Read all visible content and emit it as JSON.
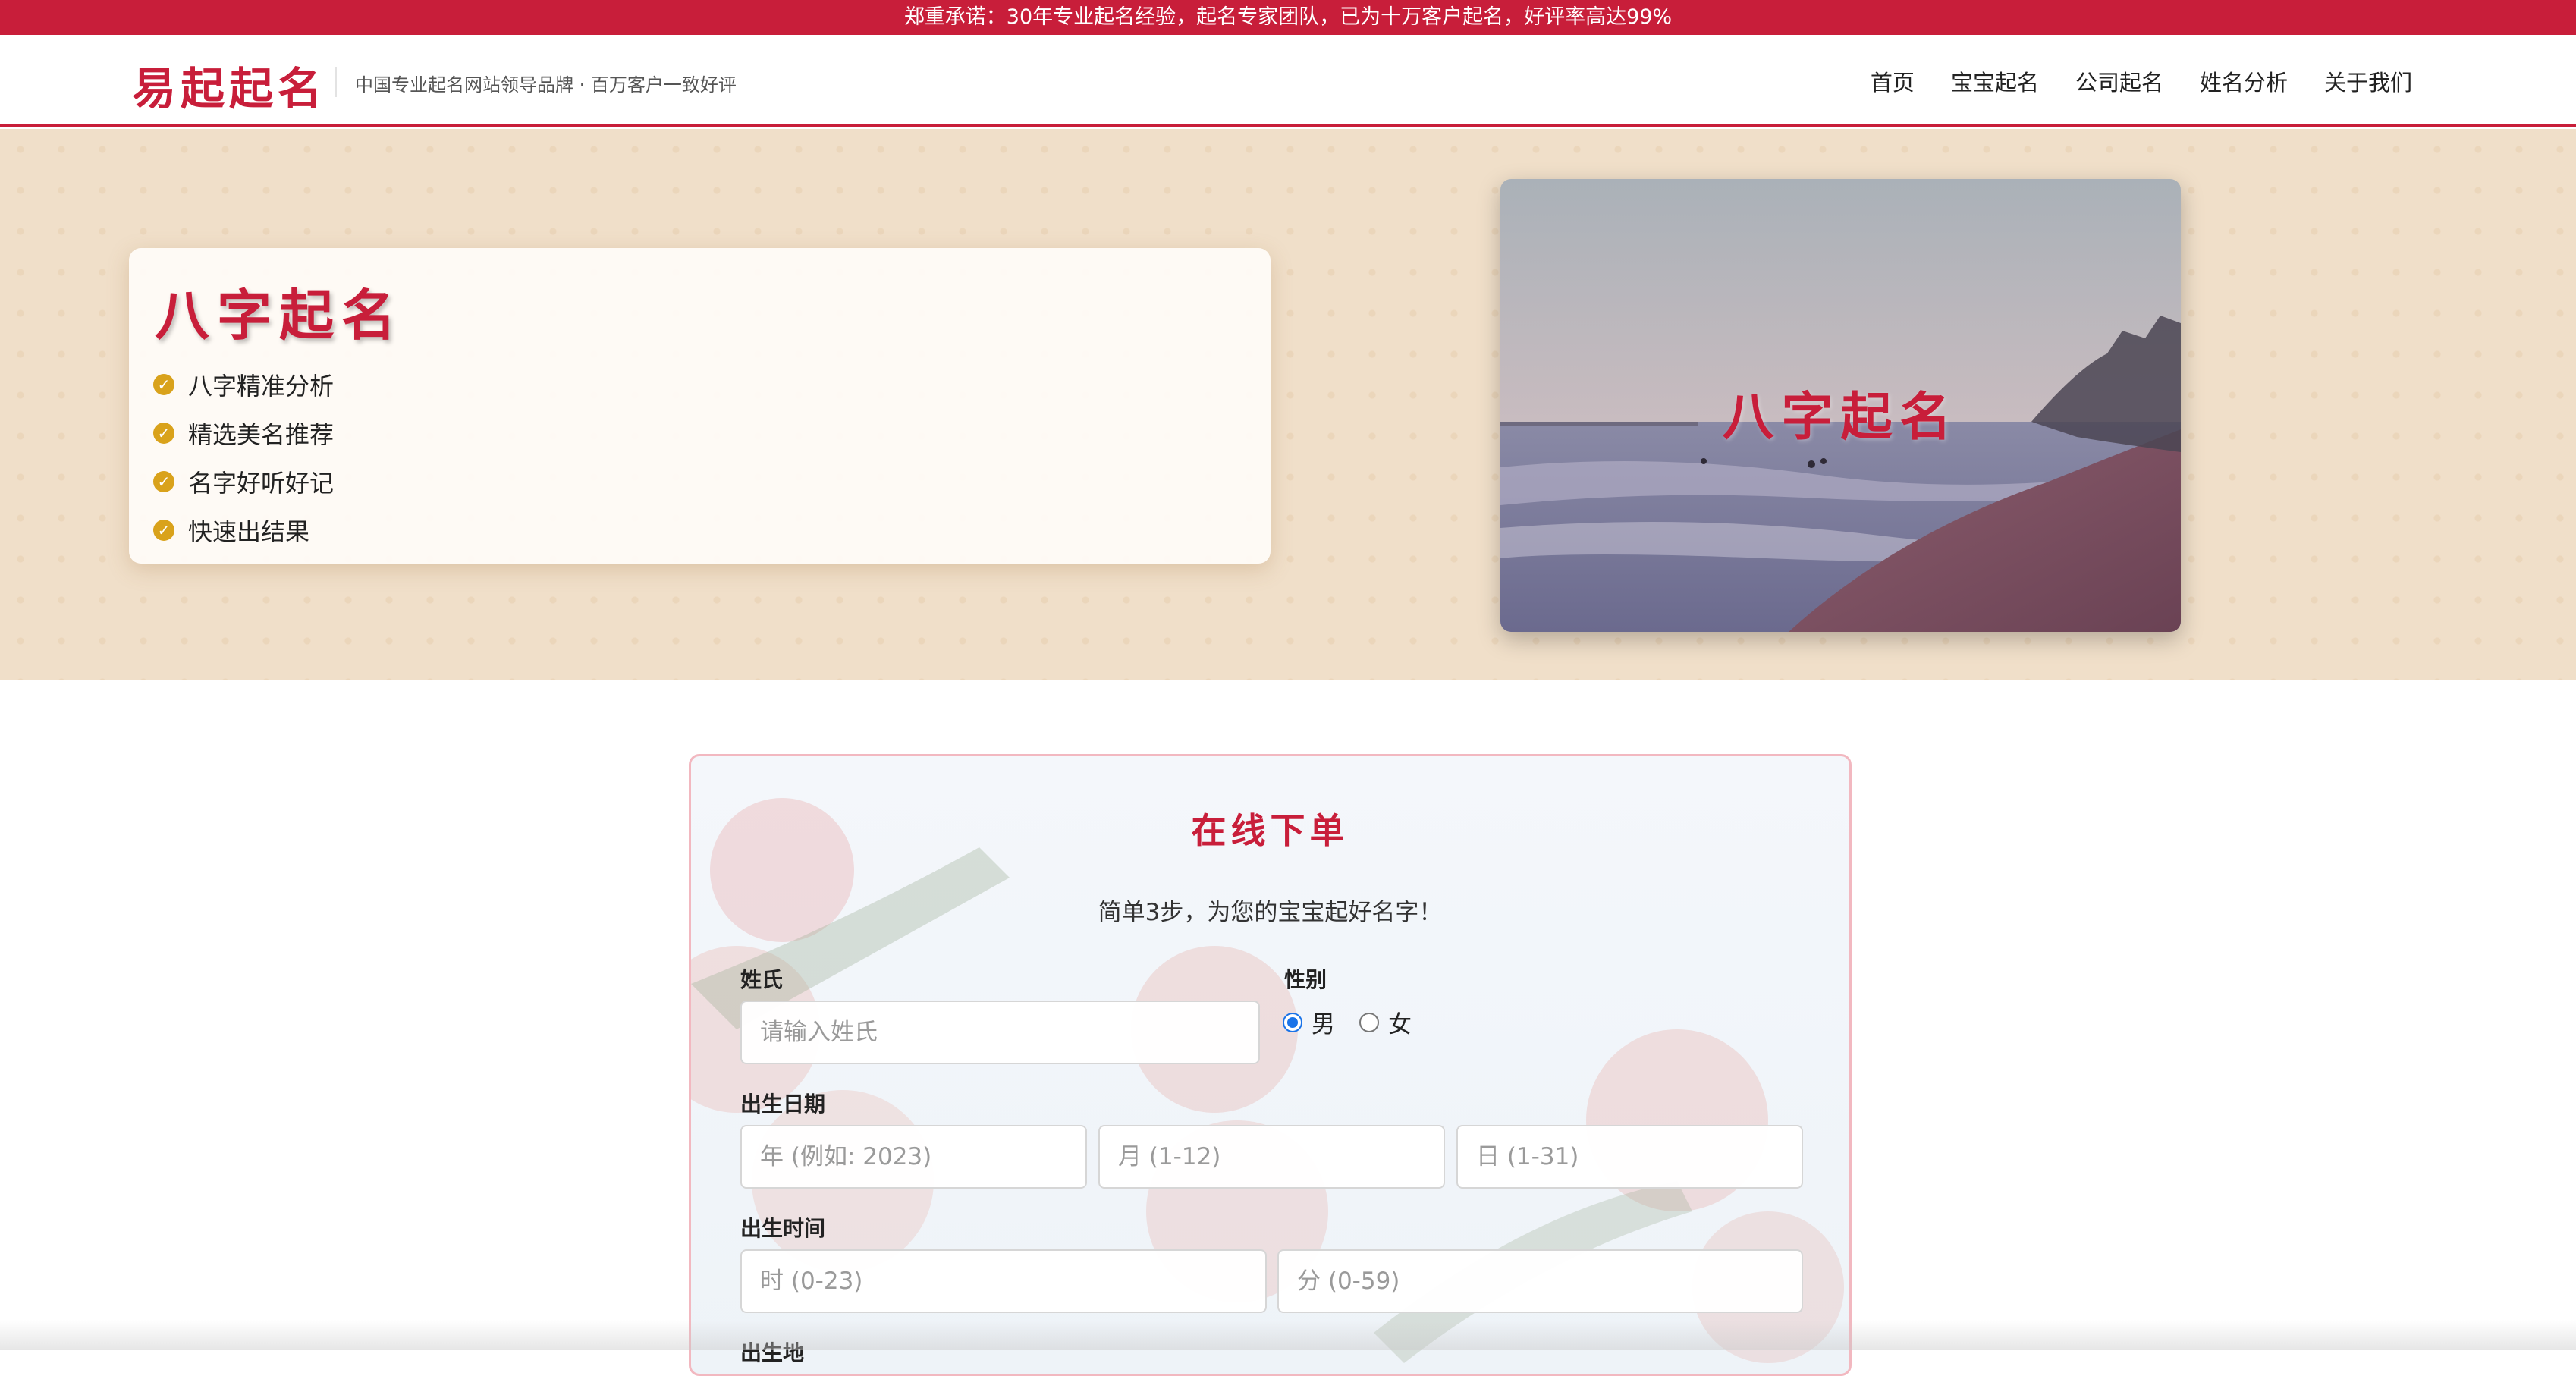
{
  "promo": {
    "text": "郑重承诺：30年专业起名经验，起名专家团队，已为十万客户起名，好评率高达99%"
  },
  "header": {
    "logo": "易起起名",
    "tagline": "中国专业起名网站领导品牌 · 百万客户一致好评",
    "nav": [
      "首页",
      "宝宝起名",
      "公司起名",
      "姓名分析",
      "关于我们"
    ]
  },
  "hero": {
    "title": "八字起名",
    "features": [
      "八字精准分析",
      "精选美名推荐",
      "名字好听好记",
      "快速出结果"
    ],
    "image_title": "八字起名"
  },
  "order": {
    "title": "在线下单",
    "subtitle": "简单3步，为您的宝宝起好名字！",
    "surname_label": "姓氏",
    "surname_placeholder": "请输入姓氏",
    "gender_label": "性别",
    "gender_options": [
      "男",
      "女"
    ],
    "gender_selected": "男",
    "birthdate_label": "出生日期",
    "year_placeholder": "年 (例如: 2023)",
    "month_placeholder": "月 (1-12)",
    "day_placeholder": "日 (1-31)",
    "birthtime_label": "出生时间",
    "hour_placeholder": "时 (0-23)",
    "minute_placeholder": "分 (0-59)",
    "birthplace_label": "出生地"
  },
  "colors": {
    "brand": "#c81e3a",
    "hero_bg": "#f0dfc9",
    "check": "#d9a21b",
    "radio": "#1a73e8"
  }
}
